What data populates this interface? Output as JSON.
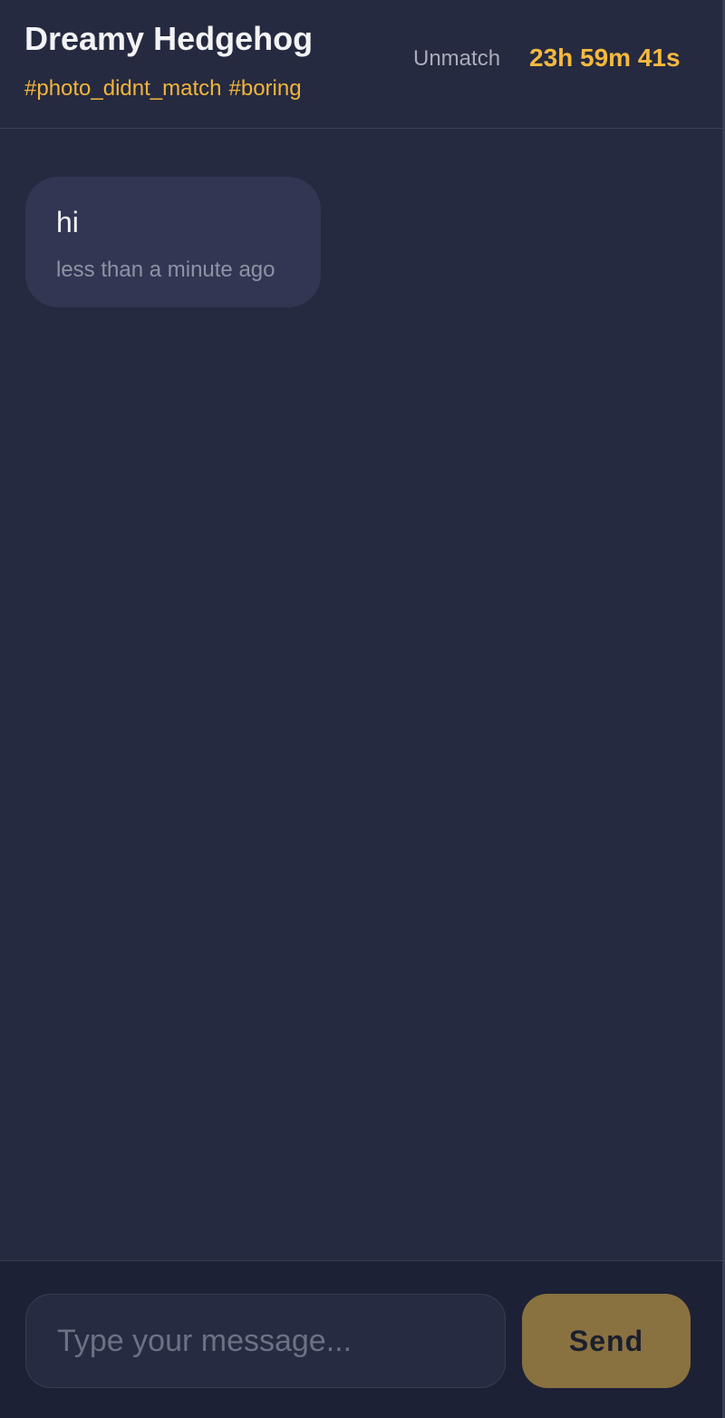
{
  "header": {
    "match_name": "Dreamy Hedgehog",
    "tags": [
      "#photo_didnt_match",
      "#boring"
    ],
    "unmatch_label": "Unmatch",
    "countdown": "23h 59m 41s"
  },
  "messages": [
    {
      "text": "hi",
      "time": "less than a minute ago"
    }
  ],
  "composer": {
    "placeholder": "Type your message...",
    "value": "",
    "send_label": "Send"
  },
  "colors": {
    "background": "#252a40",
    "accent": "#f5b93f",
    "bubble": "#313753",
    "send_button": "#8a7140"
  }
}
